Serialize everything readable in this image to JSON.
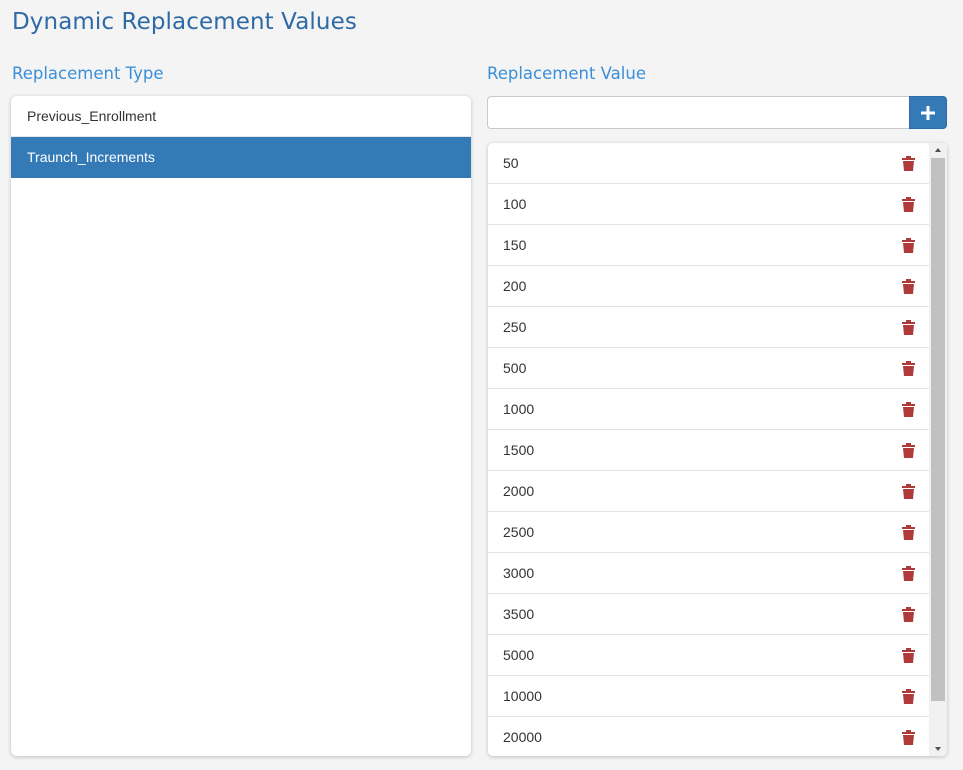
{
  "page": {
    "title": "Dynamic Replacement Values"
  },
  "replacement_type": {
    "label": "Replacement Type",
    "items": [
      {
        "label": "Previous_Enrollment",
        "selected": false
      },
      {
        "label": "Traunch_Increments",
        "selected": true
      }
    ]
  },
  "replacement_value": {
    "label": "Replacement Value",
    "input_value": "",
    "add_icon": "plus-icon",
    "delete_icon": "trash-icon",
    "values": [
      "50",
      "100",
      "150",
      "200",
      "250",
      "500",
      "1000",
      "1500",
      "2000",
      "2500",
      "3000",
      "3500",
      "5000",
      "10000",
      "20000"
    ]
  },
  "colors": {
    "title": "#2e6aa6",
    "label": "#3a8fd8",
    "selected_bg": "#337ab7",
    "delete": "#b03a3a"
  }
}
